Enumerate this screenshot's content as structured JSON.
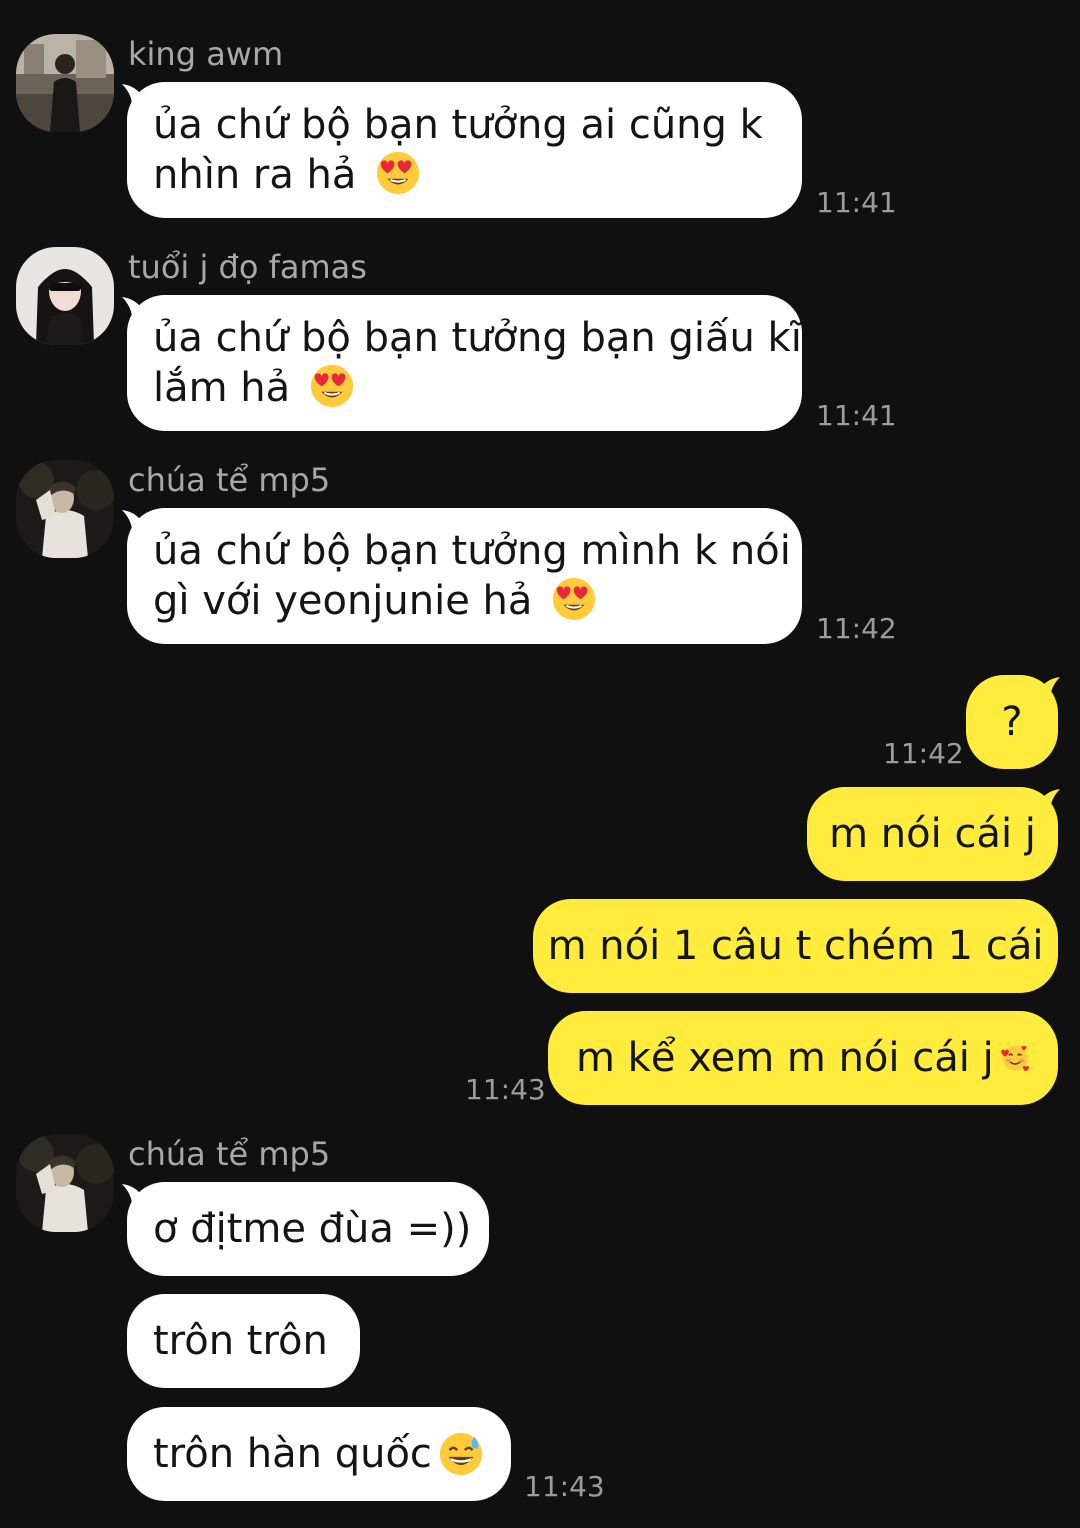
{
  "messages": {
    "m1": {
      "sender": "king awm",
      "text_line1": "ủa chứ bộ bạn tưởng ai cũng k",
      "text_line2": "nhìn ra hả",
      "emoji": "heart-eyes-emoji",
      "time": "11:41"
    },
    "m2": {
      "sender": "tuổi j đọ famas",
      "text_line1": "ủa chứ bộ bạn tưởng bạn giấu kĩ",
      "text_line2": "lắm hả",
      "emoji": "heart-eyes-emoji",
      "time": "11:41"
    },
    "m3": {
      "sender": "chúa tể mp5",
      "text_line1": "ủa chứ bộ bạn tưởng mình k nói",
      "text_line2": "gì với yeonjunie hả",
      "emoji": "heart-eyes-emoji",
      "time": "11:42"
    },
    "o1": {
      "text": "?",
      "time": "11:42"
    },
    "o2": {
      "text": "m nói cái j"
    },
    "o3": {
      "text": "m nói 1 câu t chém 1 cái"
    },
    "o4": {
      "text": "m kể xem m nói cái j",
      "emoji": "smiling-face-with-hearts-emoji",
      "time": "11:43"
    },
    "g1": {
      "sender": "chúa tể mp5",
      "text": "ơ địtme đùa =))"
    },
    "g2": {
      "text": "trôn trôn"
    },
    "g3": {
      "text": "trôn hàn quốc",
      "emoji": "sweat-smile-emoji",
      "time": "11:43"
    }
  },
  "colors": {
    "background": "#101010",
    "incoming_bubble": "#ffffff",
    "outgoing_bubble": "#ffec3d",
    "sender_text": "#a8a8a8",
    "time_text": "#9c9c9c"
  }
}
